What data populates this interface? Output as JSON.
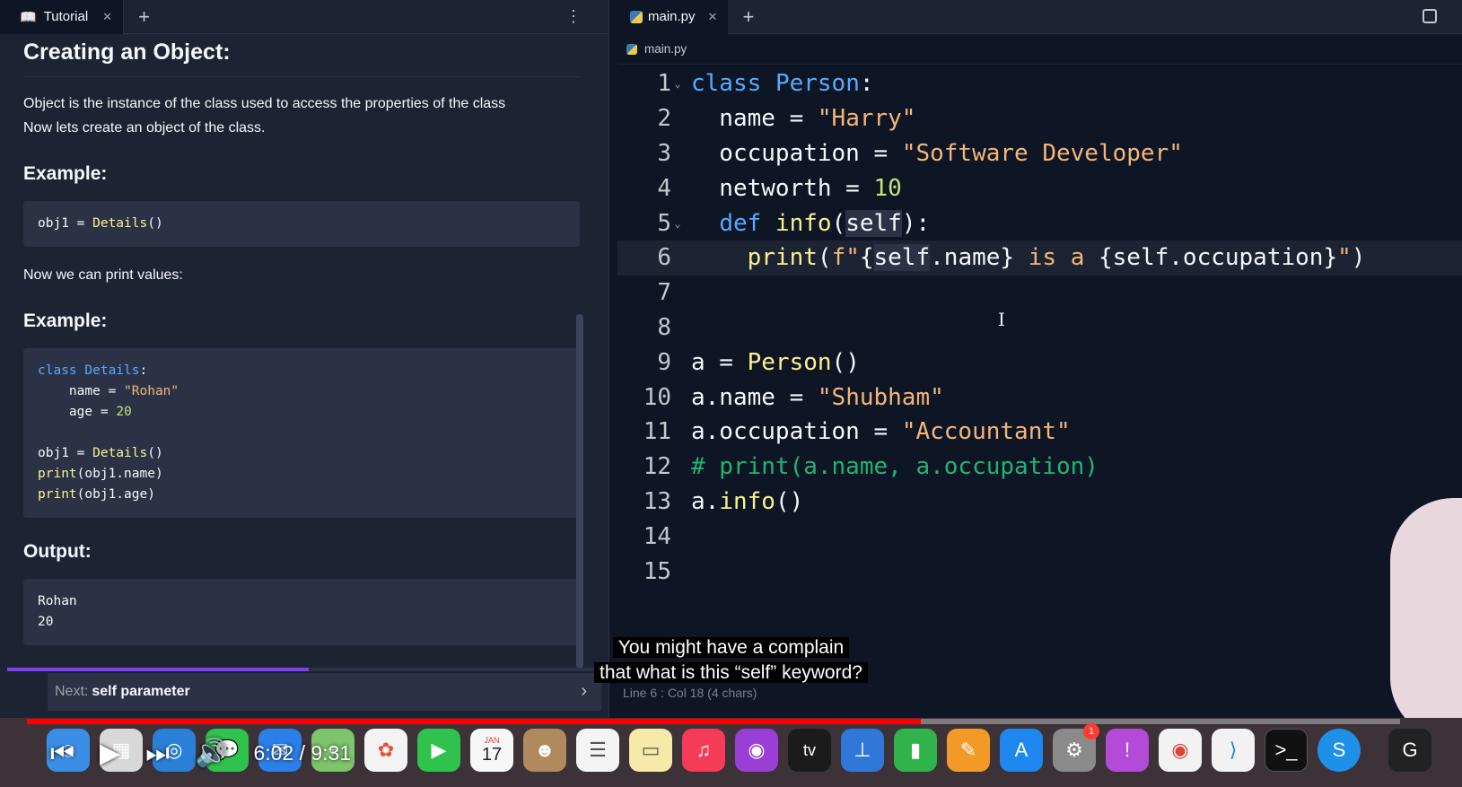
{
  "tutorial": {
    "tab_label": "Tutorial",
    "heading": "Creating an Object:",
    "intro_lines": [
      "Object is the instance of the class used to access the properties of the class",
      "Now lets create an object of the class."
    ],
    "example_label": "Example:",
    "code1": "obj1 = Details()",
    "print_values_text": "Now we can print values:",
    "example2_label": "Example:",
    "code2_lines": [
      "class Details:",
      "    name = \"Rohan\"",
      "    age = 20",
      "",
      "obj1 = Details()",
      "print(obj1.name)",
      "print(obj1.age)"
    ],
    "output_label": "Output:",
    "output_lines": [
      "Rohan",
      "20"
    ],
    "next_label": "Next:",
    "next_value": "self parameter"
  },
  "editor": {
    "tab_label": "main.py",
    "breadcrumb": "main.py",
    "status": "Line 6 : Col 18 (4 chars)",
    "line_numbers": [
      "1",
      "2",
      "3",
      "4",
      "5",
      "6",
      "7",
      "8",
      "9",
      "10",
      "11",
      "12",
      "13",
      "14",
      "15"
    ]
  },
  "subtitle": {
    "line1": "You might have a complain",
    "line2": "that what is this “self” keyword?"
  },
  "video": {
    "time": "6:02 / 9:31",
    "progress": 0.651
  },
  "dock": {
    "calendar_month": "JAN",
    "calendar_day": "17",
    "settings_badge": "1",
    "tv_label": "tv"
  },
  "colors": {
    "accent": "#7e3ff2",
    "keyword": "#57abff",
    "string": "#f5b678",
    "function": "#fcf18e",
    "number": "#c5e478",
    "comment": "#1fb573",
    "video_progress": "#ff0000"
  }
}
